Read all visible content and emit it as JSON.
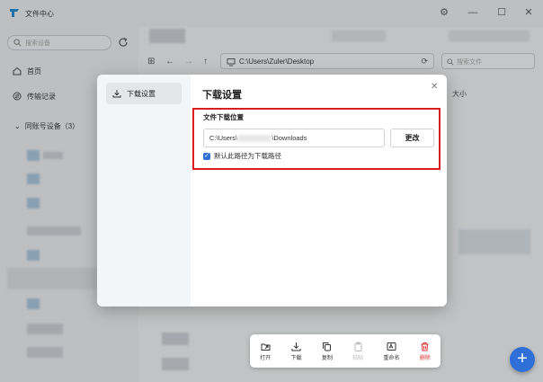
{
  "app": {
    "title": "文件中心"
  },
  "sidebar": {
    "search_placeholder": "搜索设备",
    "items": [
      {
        "label": "首页"
      },
      {
        "label": "传输记录"
      }
    ],
    "group_label": "同账号设备（3）"
  },
  "toolbar": {
    "path": "C:\\Users\\Zuler\\Desktop",
    "search_placeholder": "搜索文件"
  },
  "file_list": {
    "col_size": "大小"
  },
  "dialog": {
    "nav_label": "下载设置",
    "title": "下载设置",
    "section_label": "文件下载位置",
    "path_prefix": "C:\\Users\\",
    "path_suffix": "\\Downloads",
    "change_label": "更改",
    "checkbox_label": "默认此路径为下载路径",
    "checkbox_checked": true
  },
  "action_bar": {
    "actions": [
      {
        "label": "打开",
        "icon": "open-icon"
      },
      {
        "label": "下载",
        "icon": "download-icon"
      },
      {
        "label": "复制",
        "icon": "copy-icon"
      },
      {
        "label": "粘贴",
        "icon": "paste-icon"
      },
      {
        "label": "重命名",
        "icon": "rename-icon"
      },
      {
        "label": "删除",
        "icon": "delete-icon"
      }
    ]
  },
  "colors": {
    "accent": "#2f6fd8",
    "highlight": "#d91e1e",
    "delete": "#d33333"
  }
}
